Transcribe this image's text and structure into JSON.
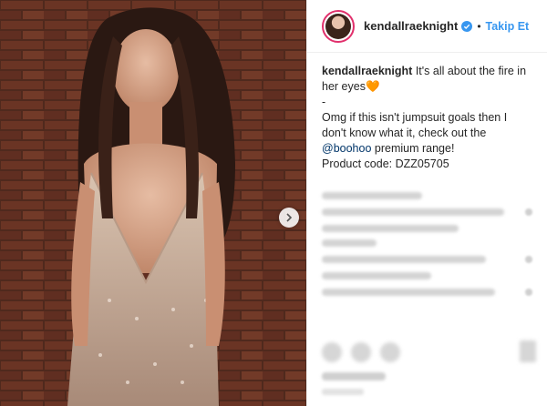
{
  "post": {
    "username": "kendallraeknight",
    "follow_label": "Takip Et",
    "separator": "•"
  },
  "caption": {
    "username": "kendallraeknight",
    "line1": " It's all about the fire in her eyes",
    "heart": "🧡",
    "dash": "-",
    "line2_pre": "Omg if this isn't jumpsuit goals then I don't know what it, check out the ",
    "mention": "@boohoo",
    "line2_post": " premium range!",
    "line3": "Product code: DZZ05705"
  },
  "colors": {
    "accent": "#3897f0",
    "verified": "#3897f0",
    "text": "#262626",
    "mention": "#003569"
  },
  "icons": {
    "next": "chevron-right-icon",
    "verified": "verified-badge-icon"
  }
}
